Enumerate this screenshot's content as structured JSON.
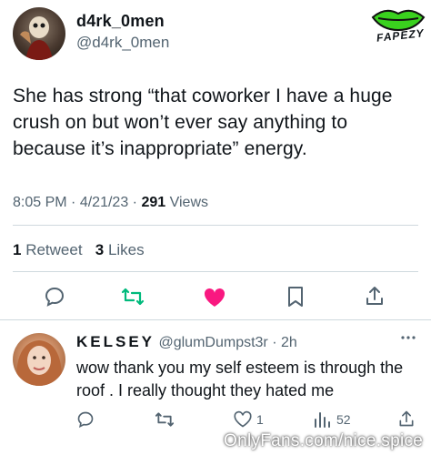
{
  "tweet": {
    "display_name": "d4rk_0men",
    "handle": "@d4rk_0men",
    "text": "She has strong “that coworker I have a huge crush on but won’t ever say anything to because it’s inappropriate” energy.",
    "time": "8:05 PM",
    "date": "4/21/23",
    "views_count": "291",
    "views_label": "Views",
    "retweets_count": "1",
    "retweets_label": "Retweet",
    "likes_count": "3",
    "likes_label": "Likes"
  },
  "reply": {
    "display_name": "KELSEY",
    "handle": "@glumDumpst3r",
    "age": "2h",
    "text": "wow thank you my self esteem is through the roof . I really thought they hated me",
    "likes_count": "1",
    "views_count": "52"
  },
  "overlays": {
    "logo_text": "FAPEZY",
    "watermark": "OnlyFans.com/nice.spice"
  },
  "colors": {
    "like_active": "#f91880",
    "retweet": "#00ba7c",
    "icon": "#536471",
    "logo_green": "#3ad11e"
  },
  "icons": [
    "reply-icon",
    "retweet-icon",
    "heart-icon",
    "bookmark-icon",
    "share-icon",
    "more-icon",
    "views-icon"
  ]
}
